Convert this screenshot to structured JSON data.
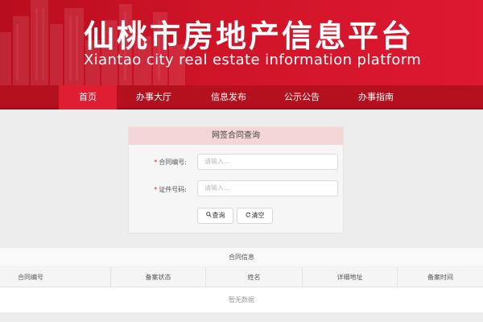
{
  "header": {
    "title": "仙桃市房地产信息平台",
    "subtitle": "Xiantao city real estate information platform"
  },
  "nav": {
    "items": [
      {
        "label": "首页",
        "active": true
      },
      {
        "label": "办事大厅",
        "active": false
      },
      {
        "label": "信息发布",
        "active": false
      },
      {
        "label": "公示公告",
        "active": false
      },
      {
        "label": "办事指南",
        "active": false
      }
    ]
  },
  "query_panel": {
    "title": "网签合同查询",
    "required_mark": "*",
    "contract_no": {
      "label": "合同编号:",
      "placeholder": "请输入..."
    },
    "id_no": {
      "label": "证件号码:",
      "placeholder": "请输入..."
    },
    "search_button": {
      "label": "查询",
      "icon": "search-icon"
    },
    "clear_button": {
      "label": "清空",
      "icon": "refresh-icon"
    }
  },
  "results": {
    "caption": "合同信息",
    "columns": [
      "合同编号",
      "备案状态",
      "姓名",
      "详细地址",
      "备案时间"
    ],
    "empty_text": "暂无数据"
  },
  "colors": {
    "brand_red": "#c8102e",
    "nav_bg": "#b5101e",
    "nav_active": "#e01e32",
    "panel_header": "#f5d6d6"
  }
}
